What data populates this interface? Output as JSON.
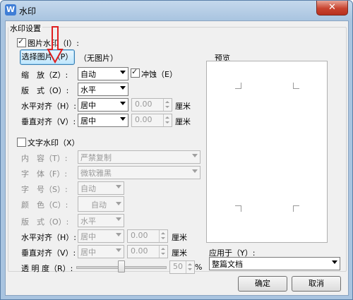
{
  "window": {
    "title": "水印",
    "app_icon": "W",
    "close_label": "✕"
  },
  "image_watermark": {
    "group_label": "水印设置",
    "checkbox_label": "图片水印（I）:",
    "checked": true,
    "select_button": "选择图片（P）",
    "no_image": "（无图片）",
    "scale_label": "缩　放（Z）:",
    "scale_value": "自动",
    "washout_label": "冲蚀（E）",
    "washout_checked": true,
    "layout_label": "版　式（O）:",
    "layout_value": "水平",
    "halign_label": "水平对齐（H）:",
    "halign_value": "居中",
    "halign_offset": "0.00",
    "valign_label": "垂直对齐（V）:",
    "valign_value": "居中",
    "valign_offset": "0.00",
    "unit": "厘米"
  },
  "text_watermark": {
    "checkbox_label": "文字水印（X）",
    "checked": false,
    "content_label": "内　容（T）:",
    "content_value": "严禁复制",
    "font_label": "字　体（F）:",
    "font_value": "微软雅黑",
    "size_label": "字　号（S）:",
    "size_value": "自动",
    "color_label": "颜　色（C）:",
    "color_value": "自动",
    "layout_label": "版　式（O）:",
    "layout_value": "水平",
    "halign_label": "水平对齐（H）:",
    "halign_value": "居中",
    "halign_offset": "0.00",
    "valign_label": "垂直对齐（V）:",
    "valign_value": "居中",
    "valign_offset": "0.00",
    "unit": "厘米",
    "transparency_label": "透 明 度（R）:",
    "transparency_value": "50",
    "percent": "%"
  },
  "preview": {
    "label": "预览"
  },
  "apply": {
    "label": "应用于（Y）:",
    "value": "整篇文档"
  },
  "buttons": {
    "ok": "确定",
    "cancel": "取消"
  },
  "colors": {
    "title_bar": "#a9c4e0",
    "close_button": "#c8432f",
    "annotation_arrow": "#e02020"
  }
}
